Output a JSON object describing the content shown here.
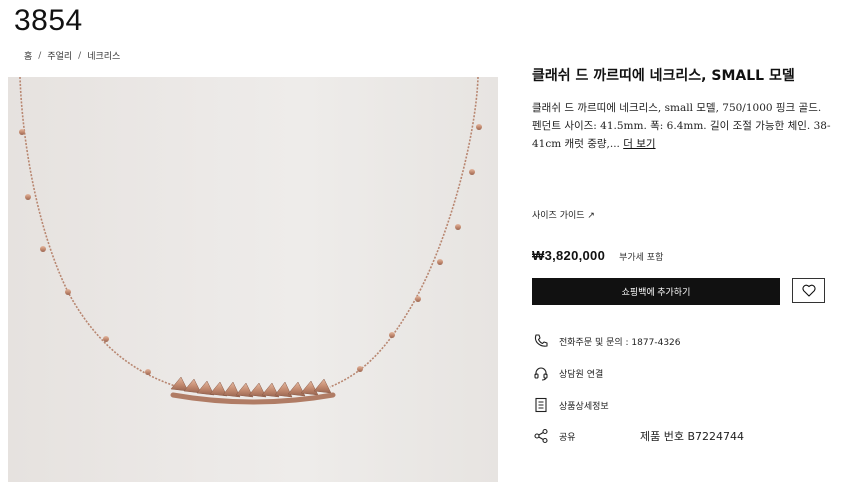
{
  "page_number": "3854",
  "breadcrumb": {
    "items": [
      "홈",
      "주얼리",
      "네크리스"
    ],
    "separator": "/"
  },
  "product": {
    "title": "클래쉬 드 까르띠에 네크리스, SMALL 모델",
    "description": "클래쉬 드 까르띠에 네크리스, small 모델, 750/1000 핑크 골드. 펜던트 사이즈: 41.5mm. 폭: 6.4mm. 길이 조절 가능한 체인. 38-41cm 캐럿 중량,...",
    "more_label": "더 보기",
    "size_guide_label": "사이즈 가이드 ↗",
    "price": "₩3,820,000",
    "vat_label": "부가세 포함",
    "add_to_cart_label": "쇼핑백에 추가하기",
    "product_code": "제품 번호 B7224744"
  },
  "services": {
    "phone": "전화주문 및 문의 : 1877-4326",
    "chat": "상담원 연결",
    "detail": "상품상세정보",
    "share": "공유"
  },
  "icons": {
    "phone": "phone-icon",
    "chat": "headset-icon",
    "detail": "document-icon",
    "share": "share-icon",
    "wishlist": "heart-icon"
  },
  "colors": {
    "button_bg": "#111111",
    "button_text": "#ffffff",
    "image_bg": "#ebe8e6",
    "gold": "#c9937a"
  }
}
